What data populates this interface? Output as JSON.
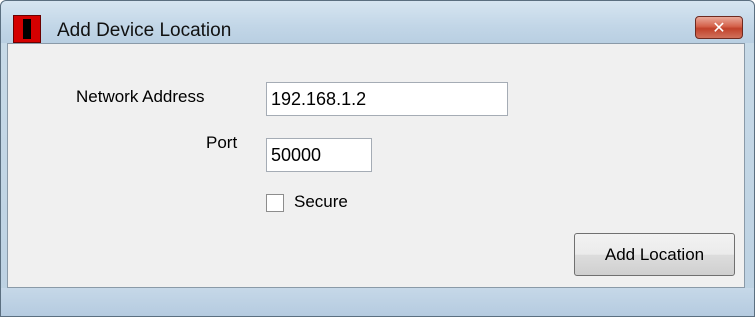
{
  "window": {
    "title": "Add Device Location",
    "close_icon": "close-icon",
    "app_icon": "app-icon"
  },
  "form": {
    "network_address_label": "Network Address",
    "network_address_value": "192.168.1.2",
    "port_label": "Port",
    "port_value": "50000",
    "secure_label": "Secure",
    "secure_checked": false
  },
  "actions": {
    "add_location_label": "Add Location"
  },
  "colors": {
    "accent_red": "#d40000",
    "close_button": "#c1412a",
    "titlebar": "#c2d6e7"
  }
}
